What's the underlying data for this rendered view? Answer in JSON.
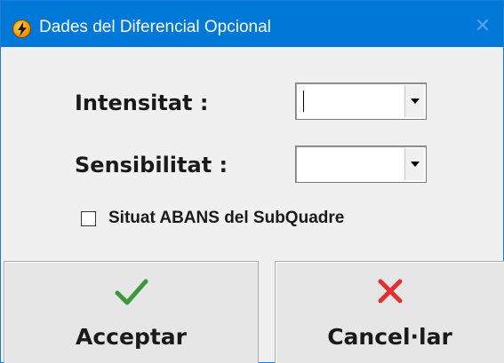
{
  "window": {
    "title": "Dades del Diferencial Opcional",
    "close_glyph": "✕"
  },
  "fields": {
    "intensitat": {
      "label": "Intensitat :",
      "value": ""
    },
    "sensibilitat": {
      "label": "Sensibilitat :",
      "value": ""
    }
  },
  "checkbox": {
    "label": "Situat ABANS del SubQuadre",
    "checked": false
  },
  "buttons": {
    "accept": {
      "label": "Acceptar",
      "icon": "check-icon",
      "icon_color": "#3a9a3a"
    },
    "cancel": {
      "label": "Cancel·lar",
      "icon": "cross-icon",
      "icon_color": "#e03030"
    }
  },
  "colors": {
    "titlebar": "#0078d7",
    "dialog_bg": "#f0f0f0"
  }
}
